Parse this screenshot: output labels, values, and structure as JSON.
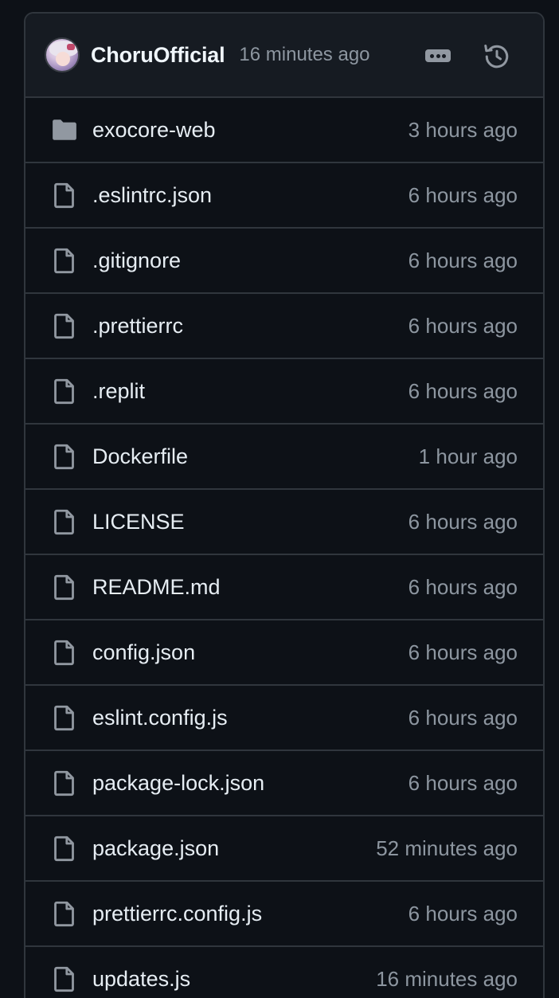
{
  "commit": {
    "author": "ChoruOfficial",
    "time": "16 minutes ago"
  },
  "icons": {
    "more": "kebab-horizontal-icon",
    "history": "history-icon",
    "folder": "folder-icon",
    "file": "file-icon"
  },
  "files": [
    {
      "name": "exocore-web",
      "time": "3 hours ago",
      "type": "folder"
    },
    {
      "name": ".eslintrc.json",
      "time": "6 hours ago",
      "type": "file"
    },
    {
      "name": ".gitignore",
      "time": "6 hours ago",
      "type": "file"
    },
    {
      "name": ".prettierrc",
      "time": "6 hours ago",
      "type": "file"
    },
    {
      "name": ".replit",
      "time": "6 hours ago",
      "type": "file"
    },
    {
      "name": "Dockerfile",
      "time": "1 hour ago",
      "type": "file"
    },
    {
      "name": "LICENSE",
      "time": "6 hours ago",
      "type": "file"
    },
    {
      "name": "README.md",
      "time": "6 hours ago",
      "type": "file"
    },
    {
      "name": "config.json",
      "time": "6 hours ago",
      "type": "file"
    },
    {
      "name": "eslint.config.js",
      "time": "6 hours ago",
      "type": "file"
    },
    {
      "name": "package-lock.json",
      "time": "6 hours ago",
      "type": "file"
    },
    {
      "name": "package.json",
      "time": "52 minutes ago",
      "type": "file"
    },
    {
      "name": "prettierrc.config.js",
      "time": "6 hours ago",
      "type": "file"
    },
    {
      "name": "updates.js",
      "time": "16 minutes ago",
      "type": "file"
    }
  ],
  "colors": {
    "background": "#0d1117",
    "header_bg": "#161b22",
    "border": "#30363d",
    "text": "#e6edf3",
    "muted": "#8d96a0",
    "icon": "#9198a1"
  }
}
